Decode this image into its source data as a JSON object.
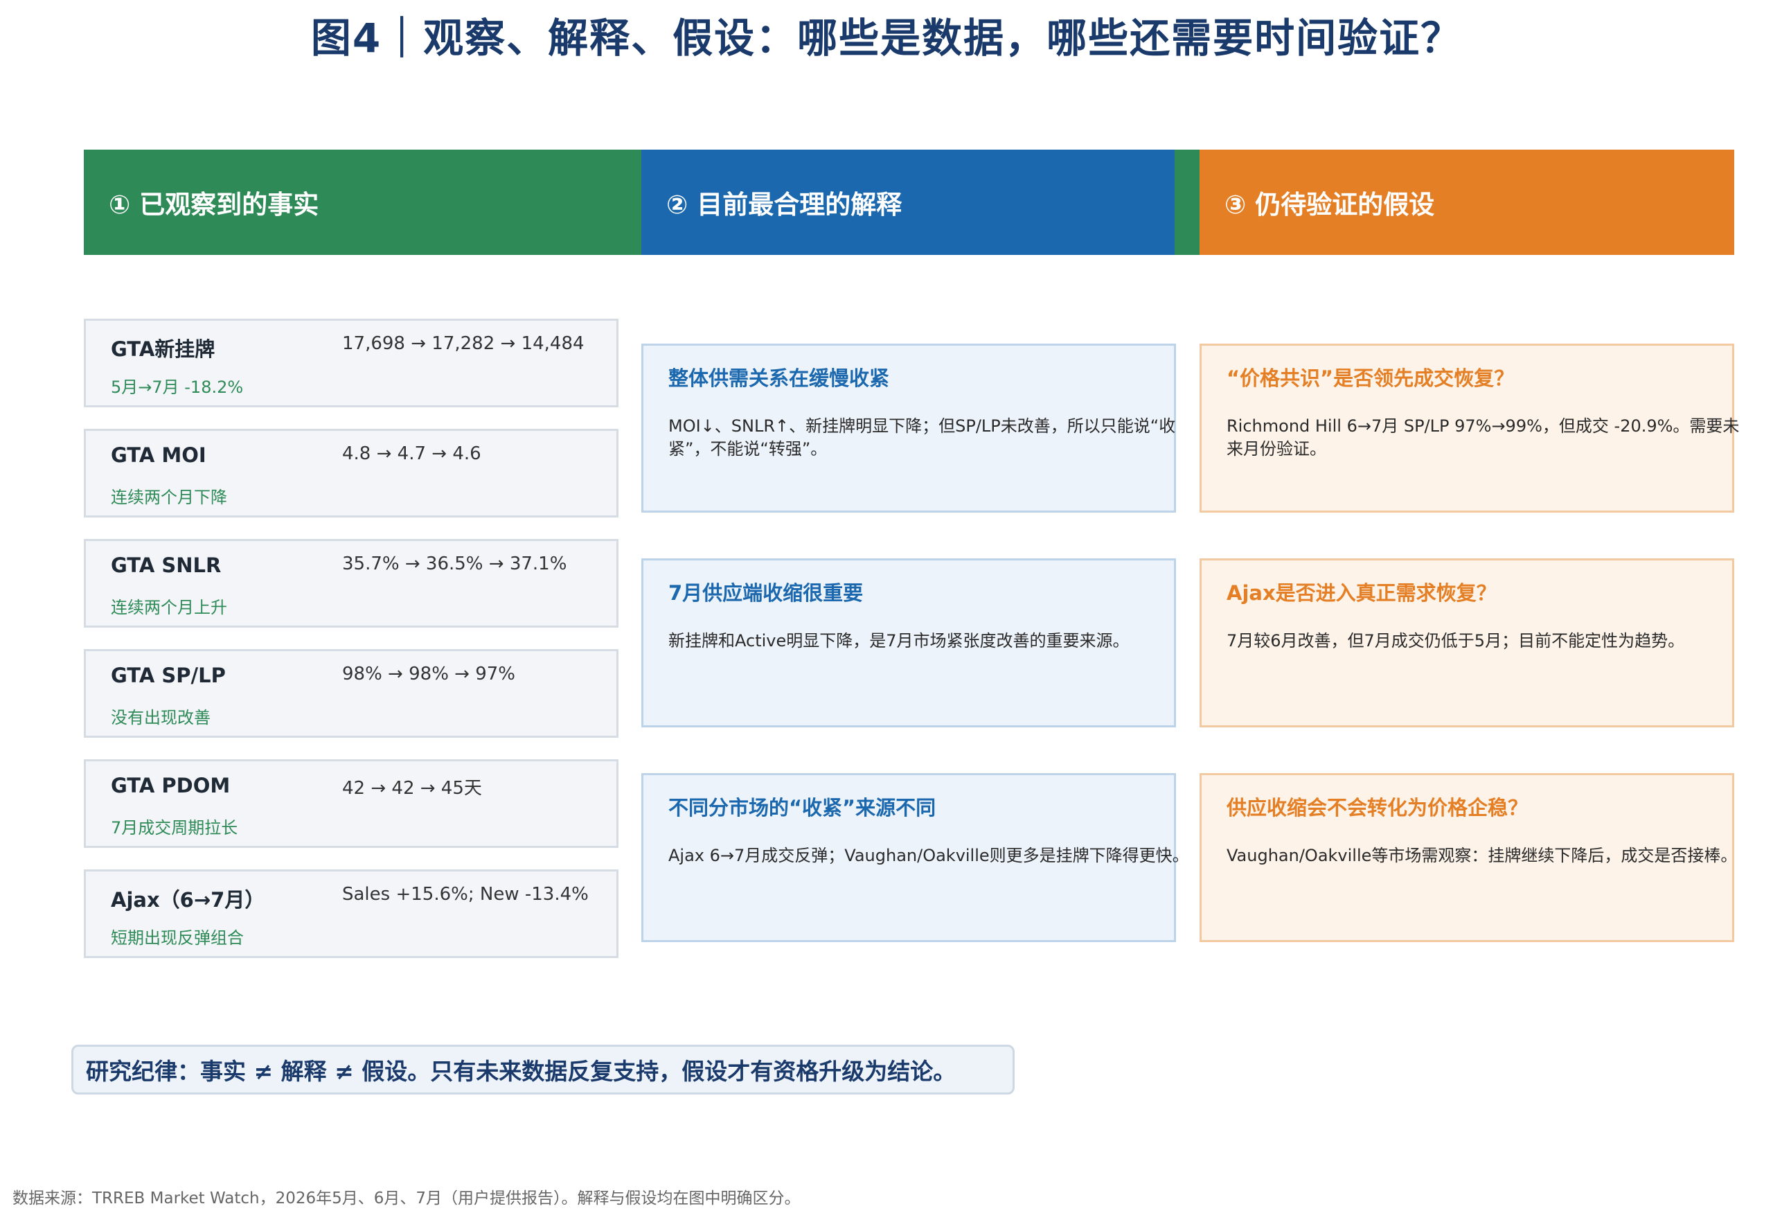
{
  "title": "图4｜观察、解释、假设：哪些是数据，哪些还需要时间验证？",
  "columns": [
    {
      "label": "① 已观察到的事实",
      "color": "#2e8b57"
    },
    {
      "label": "② 目前最合理的解释",
      "color": "#1b68ae"
    },
    {
      "label": "③ 仍待验证的假设",
      "color": "#e57f25"
    }
  ],
  "facts": [
    {
      "name": "GTA新挂牌",
      "values": "17,698 → 17,282 → 14,484",
      "note": "5月→7月 -18.2%"
    },
    {
      "name": "GTA MOI",
      "values": "4.8 → 4.7 → 4.6",
      "note": "连续两个月下降"
    },
    {
      "name": "GTA SNLR",
      "values": "35.7% → 36.5% → 37.1%",
      "note": "连续两个月上升"
    },
    {
      "name": "GTA SP/LP",
      "values": "98% → 98% → 97%",
      "note": "没有出现改善"
    },
    {
      "name": "GTA PDOM",
      "values": "42 → 42 → 45天",
      "note": "7月成交周期拉长"
    },
    {
      "name": "Ajax（6→7月）",
      "values": "Sales +15.6%; New -13.4%",
      "note": "短期出现反弹组合"
    }
  ],
  "explanations": [
    {
      "title": "整体供需关系在缓慢收紧",
      "body": "MOI↓、SNLR↑、新挂牌明显下降；但SP/LP未改善，所以只能说“收紧”，不能说“转强”。"
    },
    {
      "title": "7月供应端收缩很重要",
      "body": "新挂牌和Active明显下降，是7月市场紧张度改善的重要来源。"
    },
    {
      "title": "不同分市场的“收紧”来源不同",
      "body": "Ajax 6→7月成交反弹；Vaughan/Oakville则更多是挂牌下降得更快。"
    }
  ],
  "hypotheses": [
    {
      "title": "“价格共识”是否领先成交恢复？",
      "body": "Richmond Hill 6→7月 SP/LP 97%→99%，但成交 -20.9%。需要未来月份验证。"
    },
    {
      "title": "Ajax是否进入真正需求恢复？",
      "body": "7月较6月改善，但7月成交仍低于5月；目前不能定性为趋势。"
    },
    {
      "title": "供应收缩会不会转化为价格企稳？",
      "body": "Vaughan/Oakville等市场需观察：挂牌继续下降后，成交是否接棒。"
    }
  ],
  "discipline": "研究纪律：事实 ≠ 解释 ≠ 假设。只有未来数据反复支持，假设才有资格升级为结论。",
  "footer": "数据来源：TRREB Market Watch，2026年5月、6月、7月（用户提供报告）。解释与假设均在图中明确区分。"
}
